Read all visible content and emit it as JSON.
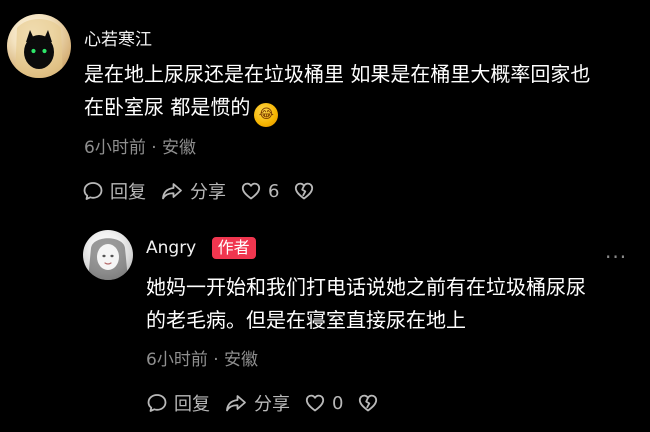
{
  "comment1": {
    "username": "心若寒江",
    "line1": "是在地上尿尿还是在垃圾桶里 如果是在桶里大概率回家也",
    "line2": "在卧室尿 都是惯的",
    "emoji": "😂",
    "meta": "6小时前 · 安徽",
    "actions": {
      "reply": "回复",
      "share": "分享",
      "likes": "6"
    }
  },
  "reply1": {
    "username": "Angry",
    "badge": "作者",
    "line1": "她妈一开始和我们打电话说她之前有在垃圾桶尿尿",
    "line2": "的老毛病。但是在寝室直接尿在地上",
    "meta": "6小时前 · 安徽",
    "more": "···",
    "actions": {
      "reply": "回复",
      "share": "分享",
      "likes": "0"
    }
  },
  "icons": {
    "reply": "comment-bubble-icon",
    "share": "share-arrow-icon",
    "like": "heart-outline-icon",
    "dislike": "broken-heart-icon"
  },
  "colors": {
    "background": "#000000",
    "text": "#ffffff",
    "meta": "#8f8f8f",
    "action": "#b9b9b9",
    "author_badge": "#f0364f"
  }
}
